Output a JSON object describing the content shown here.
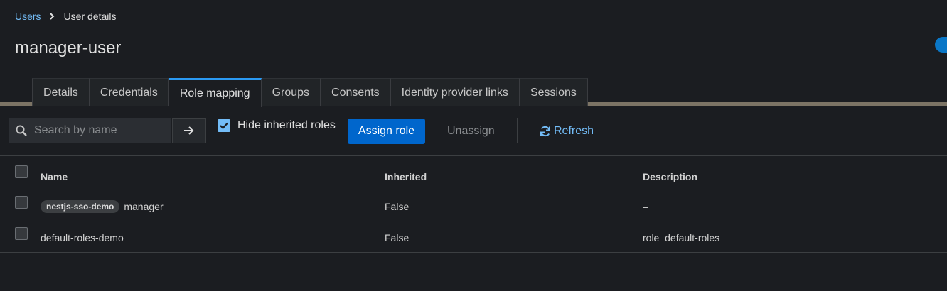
{
  "breadcrumb": {
    "parent": "Users",
    "current": "User details"
  },
  "page_title": "manager-user",
  "tabs": [
    {
      "label": "Details"
    },
    {
      "label": "Credentials"
    },
    {
      "label": "Role mapping",
      "active": true
    },
    {
      "label": "Groups"
    },
    {
      "label": "Consents"
    },
    {
      "label": "Identity provider links"
    },
    {
      "label": "Sessions"
    }
  ],
  "toolbar": {
    "search_placeholder": "Search by name",
    "hide_inherited_label": "Hide inherited roles",
    "hide_inherited_checked": true,
    "assign_label": "Assign role",
    "unassign_label": "Unassign",
    "refresh_label": "Refresh"
  },
  "table": {
    "headers": {
      "name": "Name",
      "inherited": "Inherited",
      "description": "Description"
    },
    "rows": [
      {
        "client": "nestjs-sso-demo",
        "name": "manager",
        "inherited": "False",
        "description": "–"
      },
      {
        "client": "",
        "name": "default-roles-demo",
        "inherited": "False",
        "description": "role_default-roles"
      }
    ]
  },
  "colors": {
    "accent": "#0066cc",
    "link": "#73bcf7",
    "tab_active": "#2b9af3",
    "background": "#1b1d21"
  }
}
